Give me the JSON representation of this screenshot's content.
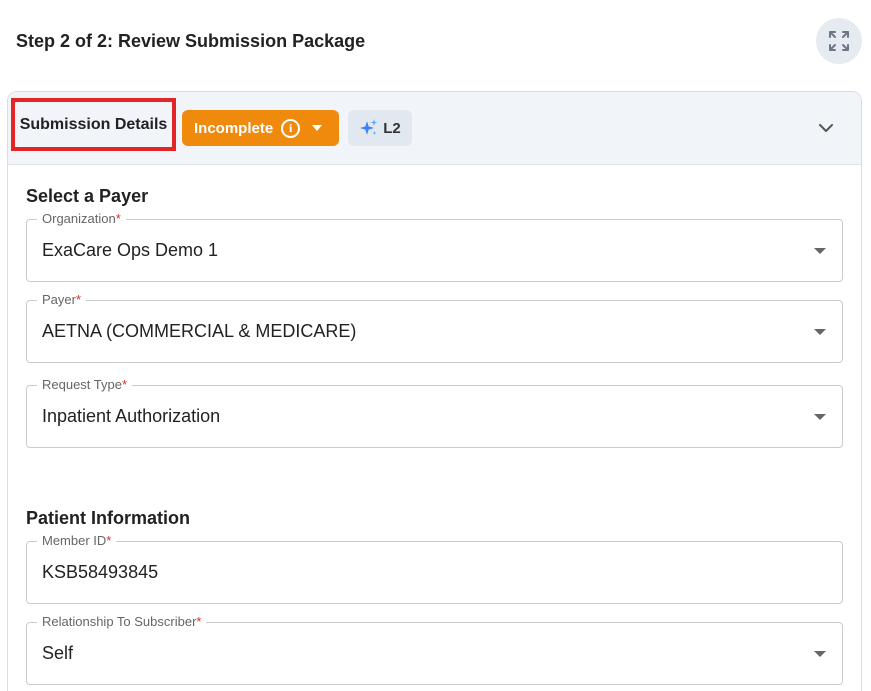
{
  "header": {
    "title": "Step 2 of 2: Review Submission Package",
    "expand_icon": "expand-arrows-icon"
  },
  "card": {
    "title": "Submission Details",
    "status": {
      "label": "Incomplete",
      "color": "#f08a0c",
      "icon": "info-circle-icon"
    },
    "level": {
      "label": "L2",
      "icon": "sparkle-icon"
    },
    "collapse_icon": "chevron-down-icon"
  },
  "payer_section": {
    "title": "Select a Payer",
    "fields": {
      "organization": {
        "label": "Organization",
        "required": "*",
        "value": "ExaCare Ops Demo 1"
      },
      "payer": {
        "label": "Payer",
        "required": "*",
        "value": "AETNA (COMMERCIAL & MEDICARE)"
      },
      "request_type": {
        "label": "Request Type",
        "required": "*",
        "value": "Inpatient Authorization"
      }
    }
  },
  "patient_section": {
    "title": "Patient Information",
    "fields": {
      "member_id": {
        "label": "Member ID",
        "required": "*",
        "value": "KSB58493845"
      },
      "relationship": {
        "label": "Relationship To Subscriber",
        "required": "*",
        "value": "Self"
      }
    }
  },
  "colors": {
    "required": "#d32f2f",
    "highlight_border": "#e32525",
    "header_bg": "#f1f4f8"
  }
}
